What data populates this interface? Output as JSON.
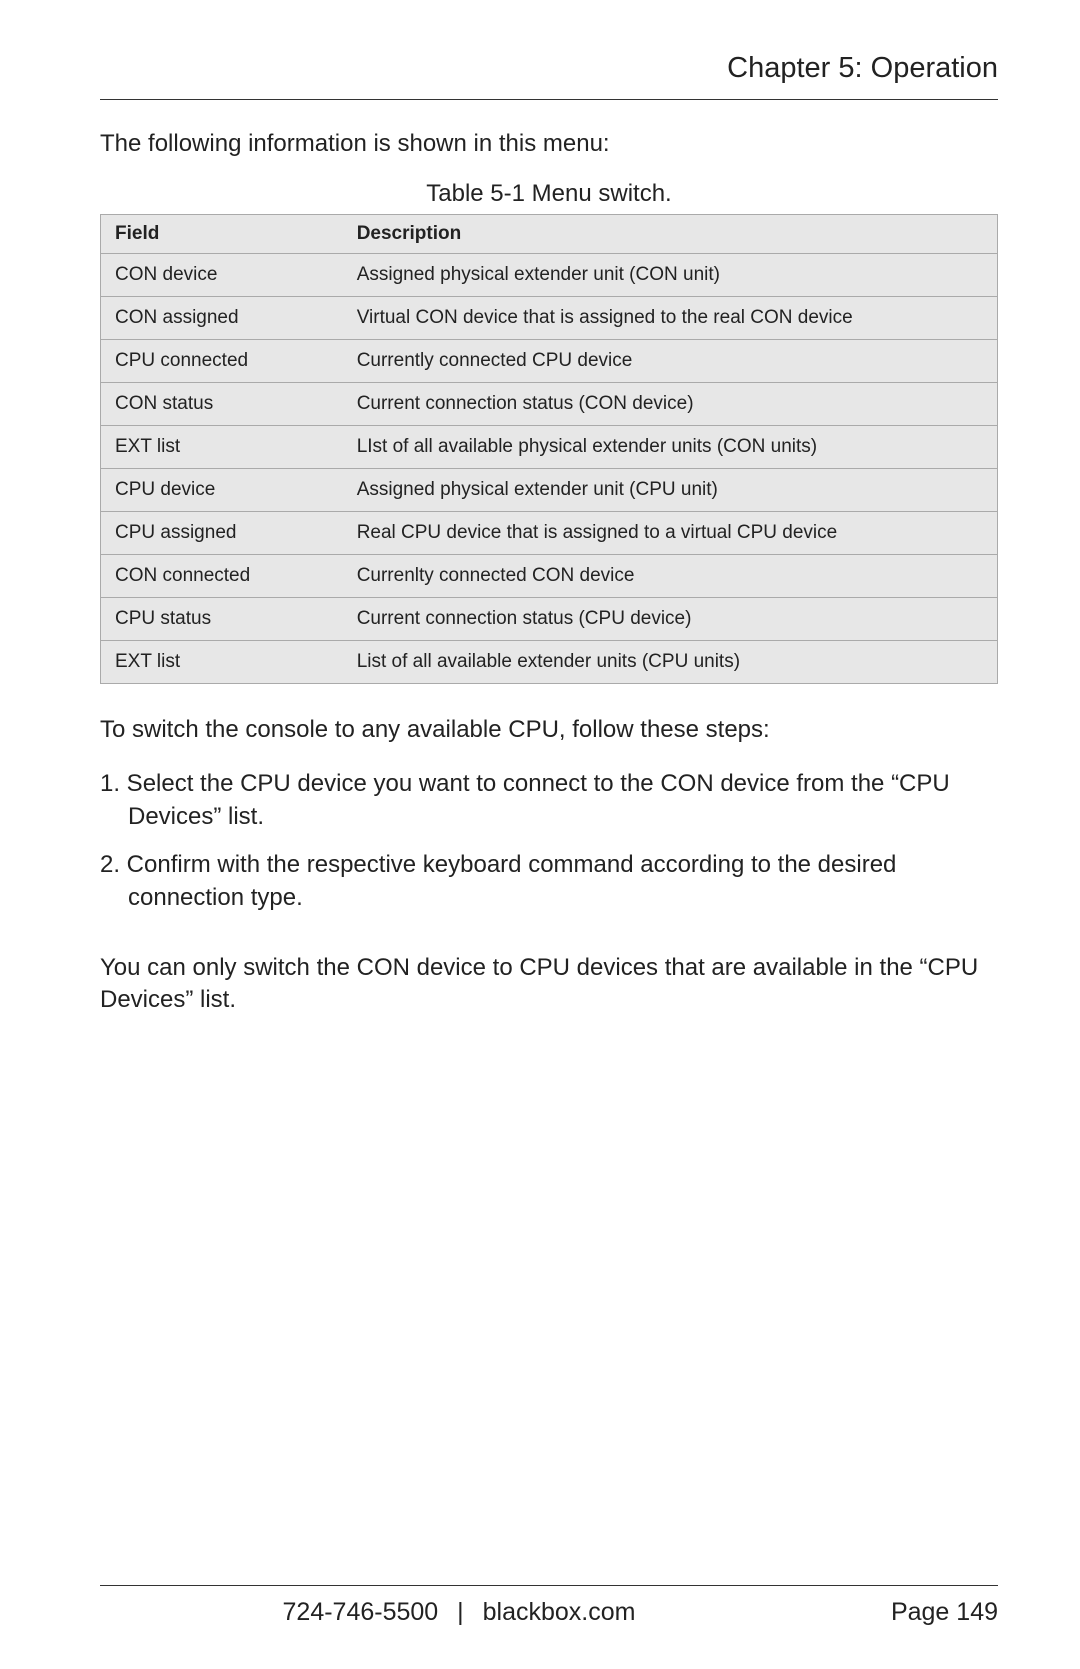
{
  "header": {
    "chapter_title": "Chapter 5: Operation"
  },
  "intro": "The following information is shown in this menu:",
  "table": {
    "caption": "Table 5-1 Menu switch.",
    "headers": {
      "field": "Field",
      "description": "Description"
    },
    "rows": [
      {
        "field": "CON device",
        "description": "Assigned physical extender unit (CON unit)"
      },
      {
        "field": "CON assigned",
        "description": "Virtual CON device that is assigned to the real CON device"
      },
      {
        "field": "CPU connected",
        "description": "Currently connected CPU device"
      },
      {
        "field": "CON status",
        "description": "Current connection status (CON device)"
      },
      {
        "field": "EXT list",
        "description": "LIst of all available physical extender units (CON units)"
      },
      {
        "field": "CPU device",
        "description": "Assigned physical extender unit (CPU unit)"
      },
      {
        "field": "CPU assigned",
        "description": "Real CPU device that is assigned to a virtual CPU device"
      },
      {
        "field": "CON connected",
        "description": "Currenlty connected CON device"
      },
      {
        "field": "CPU status",
        "description": "Current connection status (CPU device)"
      },
      {
        "field": "EXT list",
        "description": "List of all available extender units (CPU units)"
      }
    ]
  },
  "body1": "To switch the console to any available CPU, follow these steps:",
  "steps": [
    "1. Select the CPU device you want to connect to the CON device from the “CPU Devices” list.",
    "2. Confirm with the respective keyboard command according to the desired connection type."
  ],
  "body2": "You can only switch the CON device to CPU devices that are available in the “CPU Devices” list.",
  "footer": {
    "phone": "724-746-5500",
    "separator": "|",
    "site": "blackbox.com",
    "page_label": "Page 149"
  }
}
